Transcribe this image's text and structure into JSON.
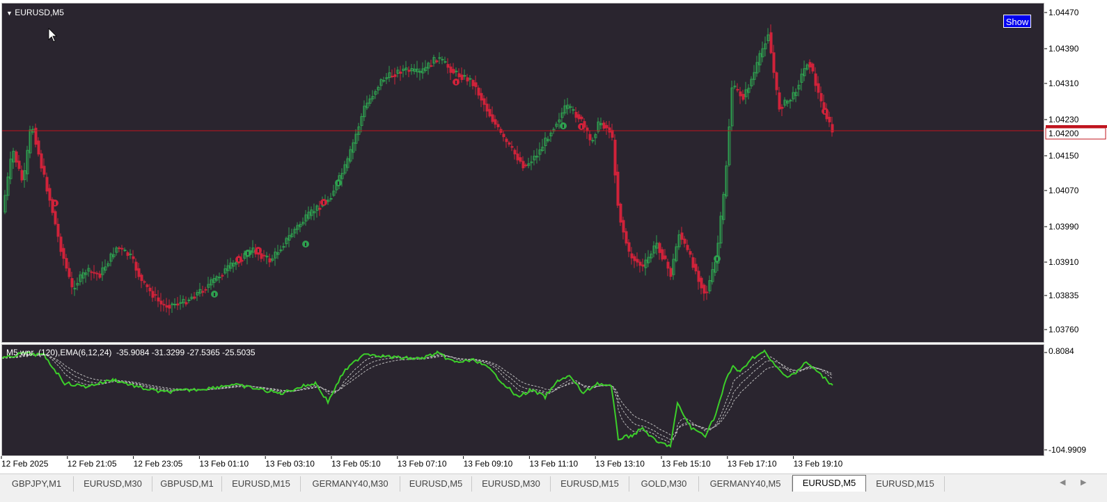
{
  "chart": {
    "title": "EURUSD,M5",
    "show_button": "Show",
    "current_price": "1.04200",
    "price_ticks": [
      "1.04470",
      "1.04390",
      "1.04310",
      "1.04230",
      "1.04150",
      "1.04070",
      "1.03990",
      "1.03910",
      "1.03835",
      "1.03760"
    ],
    "time_ticks": [
      "12 Feb 2025",
      "12 Feb 21:05",
      "12 Feb 23:05",
      "13 Feb 01:10",
      "13 Feb 03:10",
      "13 Feb 05:10",
      "13 Feb 07:10",
      "13 Feb 09:10",
      "13 Feb 11:10",
      "13 Feb 13:10",
      "13 Feb 15:10",
      "13 Feb 17:10",
      "13 Feb 19:10"
    ]
  },
  "indicator": {
    "title": "M5 wpr  (120),EMA(6,12,24)  -35.9084 -31.3299 -27.5365 -25.5035",
    "scale_top": "0.8084",
    "scale_bottom": "-104.9909"
  },
  "tabs": [
    {
      "label": "GBPJPY,M1",
      "active": false
    },
    {
      "label": "EURUSD,M30",
      "active": false
    },
    {
      "label": "GBPUSD,M1",
      "active": false
    },
    {
      "label": "EURUSD,M15",
      "active": false
    },
    {
      "label": "GERMANY40,M30",
      "active": false
    },
    {
      "label": "EURUSD,M5",
      "active": false
    },
    {
      "label": "EURUSD,M30",
      "active": false
    },
    {
      "label": "EURUSD,M15",
      "active": false
    },
    {
      "label": "GOLD,M30",
      "active": false
    },
    {
      "label": "GERMANY40,M5",
      "active": false
    },
    {
      "label": "EURUSD,M5",
      "active": true
    },
    {
      "label": "EURUSD,M15",
      "active": false
    }
  ],
  "colors": {
    "background": "#2a252f",
    "bull": "#2ea04f",
    "bear": "#d0223a",
    "price_line": "#c0141e",
    "wpr_line": "#3ccf2a",
    "ema_lines": "#bfbfbf"
  }
}
